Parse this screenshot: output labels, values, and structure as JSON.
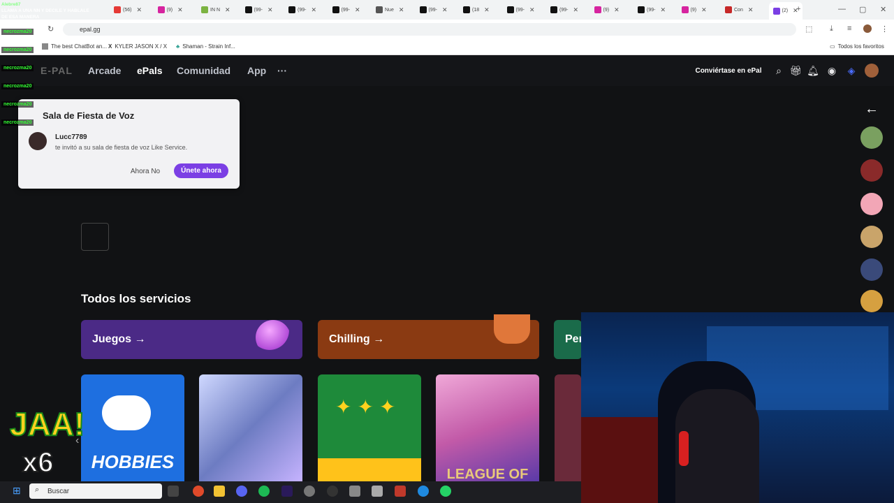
{
  "browser": {
    "tabs": [
      {
        "label": "(56)",
        "color": "#e53935"
      },
      {
        "label": "(9)",
        "color": "#d6249f"
      },
      {
        "label": "IN N",
        "color": "#7cb342"
      },
      {
        "label": "(99-",
        "color": "#111111"
      },
      {
        "label": "(99-",
        "color": "#111111"
      },
      {
        "label": "(99-",
        "color": "#111111"
      },
      {
        "label": "Nue",
        "color": "#555555"
      },
      {
        "label": "(99-",
        "color": "#111111"
      },
      {
        "label": "(18",
        "color": "#111111"
      },
      {
        "label": "(99-",
        "color": "#111111"
      },
      {
        "label": "(99-",
        "color": "#111111"
      },
      {
        "label": "(9)",
        "color": "#d6249f"
      },
      {
        "label": "(99-",
        "color": "#111111"
      },
      {
        "label": "(9)",
        "color": "#d6249f"
      },
      {
        "label": "Con",
        "color": "#c62828"
      },
      {
        "label": "(2)",
        "color": "#7b3fe4"
      }
    ],
    "url": "epal.gg",
    "bookmarks": [
      "The best ChatBot an...",
      "KYLER JASON X / X",
      "Shaman - Strain Inf..."
    ],
    "all_bookmarks": "Todos los favoritos"
  },
  "overlay": {
    "alert_user": "Alebre87",
    "alert_text": "LLAMA A UNA NN Y DECILE Y HABLALE DE ESA MANERA",
    "chat_users": [
      "necrozma20",
      "necrozma20",
      "necrozma20",
      "necrozma20",
      "necrozma20",
      "necrozma20"
    ],
    "reaction": "JAA!",
    "multiplier": "x6"
  },
  "site": {
    "logo": "E-PAL",
    "nav": [
      "Arcade",
      "ePals",
      "Comunidad",
      "App"
    ],
    "more": "···",
    "become_epal": "Conviértase en ePal"
  },
  "popup": {
    "title": "Sala de Fiesta de Voz",
    "username": "Lucc7789",
    "message": "te invitó a su sala de fiesta de voz Like Service.",
    "decline": "Ahora No",
    "accept": "Únete ahora"
  },
  "services": {
    "title": "Todos los servicios",
    "categories": [
      {
        "label": "Juegos →",
        "color": "#4b2a86"
      },
      {
        "label": "Chilling →",
        "color": "#8a3a12"
      },
      {
        "label": "Per",
        "color": "#1a6b4a"
      }
    ],
    "thumbs": [
      {
        "label": "HOBBIES",
        "color": "#1e6fe0"
      },
      {
        "label": "",
        "color": "#6d7cc2"
      },
      {
        "label": "",
        "color": "#1e8a3a"
      },
      {
        "label": "LEAGUE OF",
        "color": "#c25aa8"
      }
    ]
  },
  "taskbar": {
    "search": "Buscar"
  }
}
